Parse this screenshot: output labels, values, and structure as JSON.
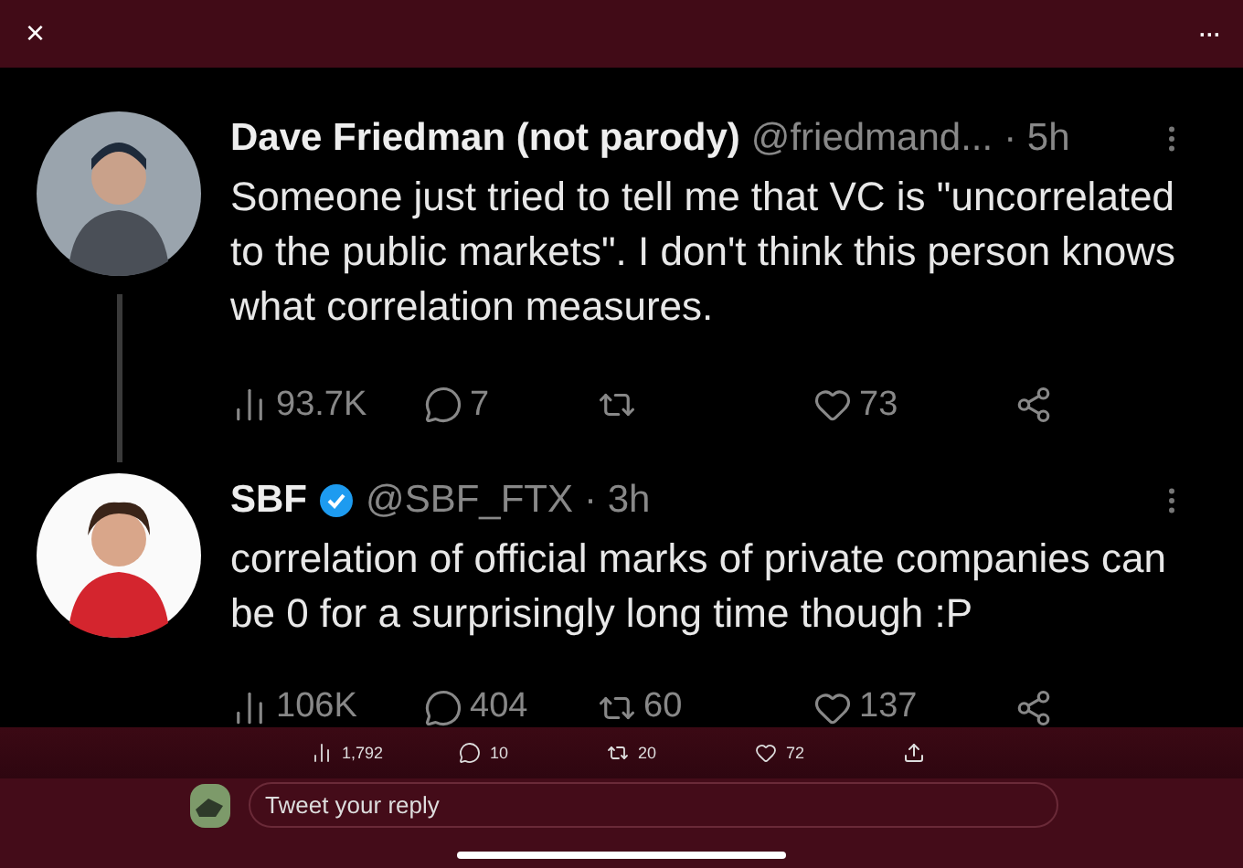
{
  "top_bar": {
    "close": "×",
    "more": "···"
  },
  "tweets": [
    {
      "name": "Dave Friedman (not parody)",
      "verified": false,
      "handle": "@friedmand...",
      "time": "· 5h",
      "text": "Someone just tried to tell me that VC is \"uncorrelated to the public markets\". I don't think this person knows what correlation measures.",
      "stats": [
        {
          "kind": "views",
          "count": "93.7K"
        },
        {
          "kind": "reply",
          "count": "7"
        },
        {
          "kind": "retweet"
        },
        {
          "kind": "like",
          "count": "73"
        },
        {
          "kind": "share"
        }
      ]
    },
    {
      "name": "SBF",
      "verified": true,
      "handle": "@SBF_FTX",
      "time": "· 3h",
      "text": "correlation of official marks of private companies can be 0 for a surprisingly long time though :P",
      "stats": [
        {
          "kind": "views",
          "count": "106K"
        },
        {
          "kind": "reply",
          "count": "404"
        },
        {
          "kind": "retweet",
          "count": "60"
        },
        {
          "kind": "like",
          "count": "137"
        },
        {
          "kind": "share"
        }
      ]
    }
  ],
  "action_bar": [
    {
      "kind": "views",
      "count": "1,792"
    },
    {
      "kind": "reply",
      "count": "10"
    },
    {
      "kind": "retweet",
      "count": "20"
    },
    {
      "kind": "like",
      "count": "72"
    },
    {
      "kind": "share"
    }
  ],
  "reply": {
    "placeholder": "Tweet your reply"
  }
}
